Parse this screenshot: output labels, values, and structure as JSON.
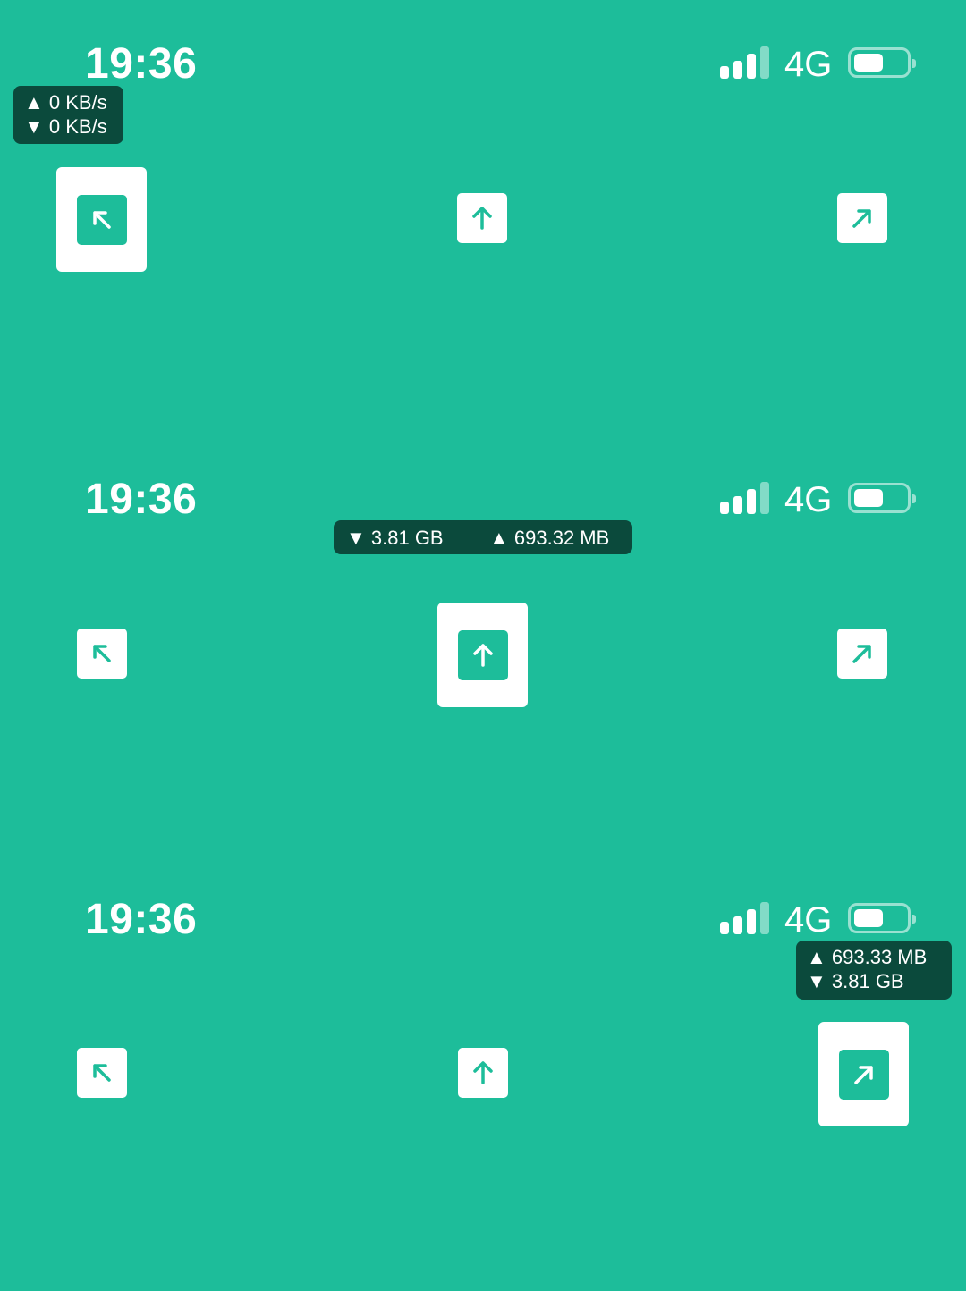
{
  "colors": {
    "background": "#1dbd9a",
    "badge": "#0b4a3c",
    "button": "#ffffff"
  },
  "panels": [
    {
      "status_bar": {
        "time": "19:36",
        "network": "4G"
      },
      "badge": {
        "line1": "▲ 0 KB/s",
        "line2": "▼ 0 KB/s"
      },
      "selected_position": "top-left",
      "buttons": [
        {
          "icon": "arrow-up-left-icon"
        },
        {
          "icon": "arrow-up-icon"
        },
        {
          "icon": "arrow-up-right-icon"
        }
      ]
    },
    {
      "status_bar": {
        "time": "19:36",
        "network": "4G"
      },
      "badge": {
        "left": "▼ 3.81 GB",
        "right": "▲ 693.32 MB"
      },
      "selected_position": "top-center",
      "buttons": [
        {
          "icon": "arrow-up-left-icon"
        },
        {
          "icon": "arrow-up-icon"
        },
        {
          "icon": "arrow-up-right-icon"
        }
      ]
    },
    {
      "status_bar": {
        "time": "19:36",
        "network": "4G"
      },
      "badge": {
        "line1": "▲ 693.33 MB",
        "line2": "▼ 3.81 GB"
      },
      "selected_position": "top-right",
      "buttons": [
        {
          "icon": "arrow-up-left-icon"
        },
        {
          "icon": "arrow-up-icon"
        },
        {
          "icon": "arrow-up-right-icon"
        }
      ]
    }
  ]
}
